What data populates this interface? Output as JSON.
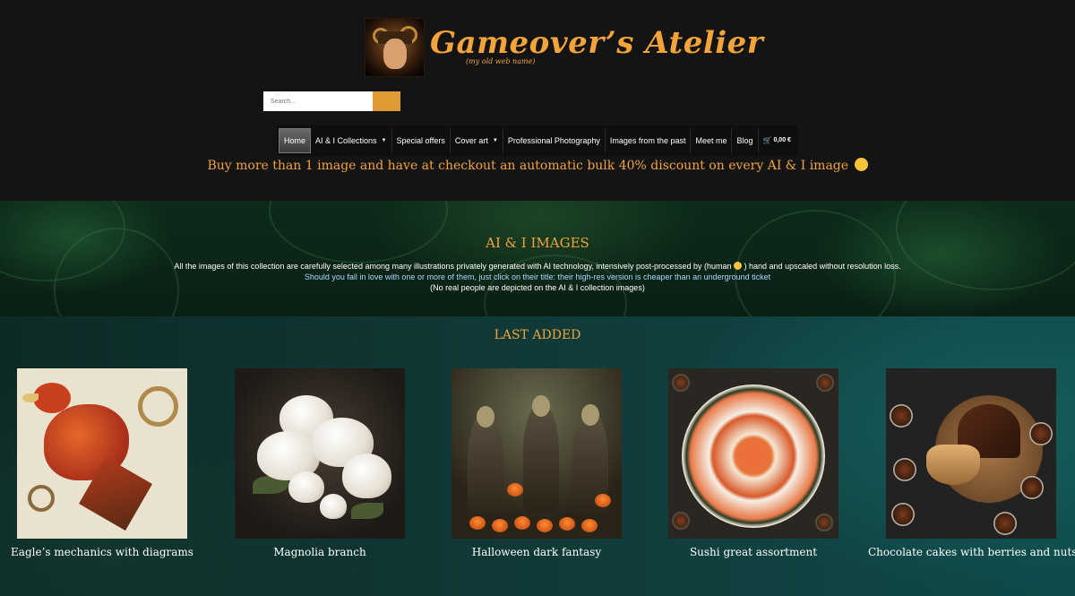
{
  "header": {
    "logo_title": "Gameover’s Atelier",
    "logo_subtitle": "(my old web name)",
    "search_placeholder": "Search..."
  },
  "nav": {
    "items": [
      {
        "label": "Home",
        "active": true
      },
      {
        "label": "AI & I Collections",
        "dropdown": true
      },
      {
        "label": "Special offers"
      },
      {
        "label": "Cover art",
        "dropdown": true
      },
      {
        "label": "Professional Photography"
      },
      {
        "label": "Images from the past"
      },
      {
        "label": "Meet me"
      },
      {
        "label": "Blog"
      }
    ],
    "cart_total": "0,00 €"
  },
  "promo": "Buy more than 1 image and have at checkout an automatic bulk 40% discount on every AI & I image",
  "banner": {
    "title": "AI & I IMAGES",
    "line1_a": "All the images of this collection are carefully selected among many illustrations privately generated with AI technology, intensively post-processed by (human",
    "line1_b": ") hand and upscaled without resolution loss.",
    "line2": "Should you fall in love with one or more of them, just click on their title: their high-res version is cheaper than an underground ticket",
    "line3": "(No real people are depicted on the AI & I collection images)"
  },
  "last_added": {
    "title": "LAST ADDED",
    "items": [
      {
        "title": "Eagle’s mechanics with diagrams"
      },
      {
        "title": "Magnolia branch"
      },
      {
        "title": "Halloween dark fantasy"
      },
      {
        "title": "Sushi great assortment"
      },
      {
        "title": "Chocolate cakes with berries and nuts"
      }
    ]
  },
  "colors": {
    "accent": "#f2a33a",
    "background": "#141414",
    "search_button": "#e09a34",
    "link_blue": "#a9d8ff"
  }
}
